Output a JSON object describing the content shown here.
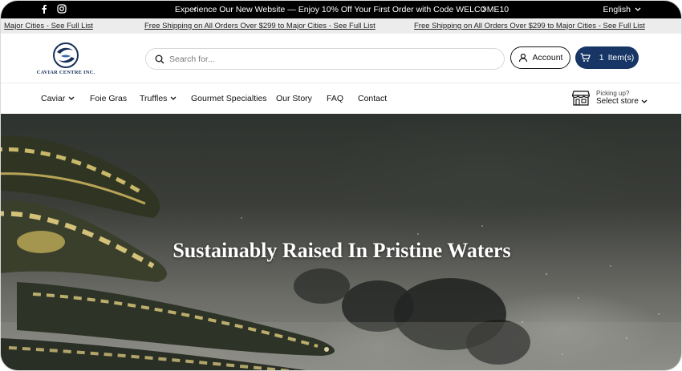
{
  "announcement": {
    "message": "Experience Our New Website — Enjoy 10% Off Your First Order with Code WELCOME10",
    "language": "English",
    "social": [
      "facebook-icon",
      "instagram-icon"
    ]
  },
  "marquee": {
    "items": [
      "Major Cities - See Full List",
      "Free Shipping on All Orders Over $299 to Major Cities - See Full List",
      "Free Shipping on All Orders Over $299 to Major Cities - See Full List"
    ]
  },
  "header": {
    "logo_text": "CAVIAR CENTRE INC.",
    "search_placeholder": "Search for...",
    "account_label": "Account",
    "cart_count": "1",
    "cart_label": "Item(s)"
  },
  "nav": {
    "items": [
      {
        "label": "Caviar",
        "dropdown": true
      },
      {
        "label": "Foie Gras",
        "dropdown": false
      },
      {
        "label": "Truffles",
        "dropdown": true
      },
      {
        "label": "Gourmet Specialties",
        "dropdown": false
      },
      {
        "label": "Our Story",
        "dropdown": false
      },
      {
        "label": "FAQ",
        "dropdown": false
      },
      {
        "label": "Contact",
        "dropdown": false
      }
    ],
    "store": {
      "label": "Picking up?",
      "select_label": "Select store"
    }
  },
  "hero": {
    "headline": "Sustainably Raised In Pristine Waters"
  },
  "colors": {
    "announcement_bg": "#000000",
    "cart_button_bg": "#173666",
    "logo_blue": "#16305a"
  }
}
